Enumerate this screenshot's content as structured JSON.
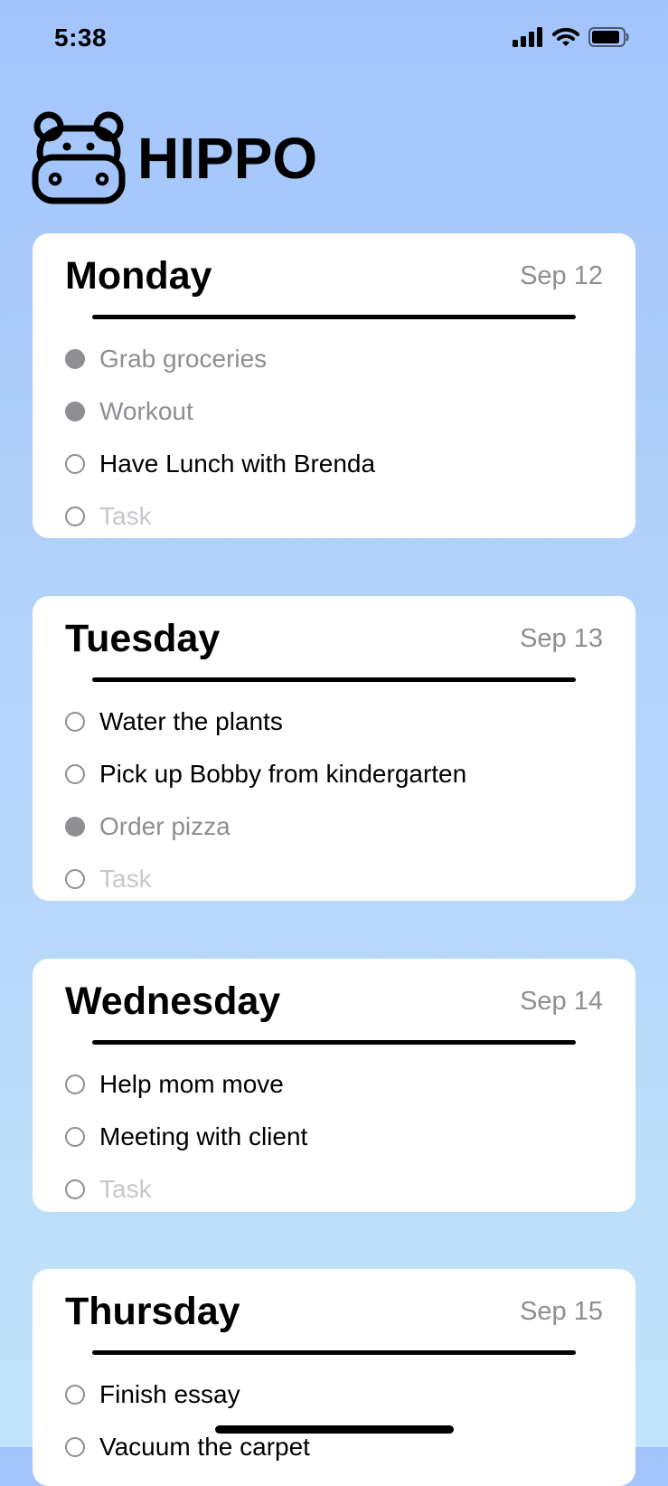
{
  "status_bar": {
    "time": "5:38"
  },
  "app": {
    "title": "HIPPO"
  },
  "days": [
    {
      "name": "Monday",
      "date": "Sep 12",
      "tasks": [
        {
          "label": "Grab groceries",
          "state": "done"
        },
        {
          "label": "Workout",
          "state": "done"
        },
        {
          "label": "Have Lunch with Brenda",
          "state": "open"
        },
        {
          "label": "Task",
          "state": "placeholder"
        }
      ]
    },
    {
      "name": "Tuesday",
      "date": "Sep 13",
      "tasks": [
        {
          "label": "Water the plants",
          "state": "open"
        },
        {
          "label": "Pick up Bobby from kindergarten",
          "state": "open"
        },
        {
          "label": "Order pizza",
          "state": "done"
        },
        {
          "label": "Task",
          "state": "placeholder"
        }
      ]
    },
    {
      "name": "Wednesday",
      "date": "Sep 14",
      "tasks": [
        {
          "label": "Help mom move",
          "state": "open"
        },
        {
          "label": "Meeting with client",
          "state": "open"
        },
        {
          "label": "Task",
          "state": "placeholder"
        }
      ]
    },
    {
      "name": "Thursday",
      "date": "Sep 15",
      "tasks": [
        {
          "label": "Finish essay",
          "state": "open"
        },
        {
          "label": "Vacuum the carpet",
          "state": "open"
        }
      ]
    }
  ],
  "colors": {
    "background_top": "#a3c4fb",
    "background_bottom": "#c1e3fa",
    "completed": "#8e8e93",
    "placeholder": "#c7c7cc"
  }
}
